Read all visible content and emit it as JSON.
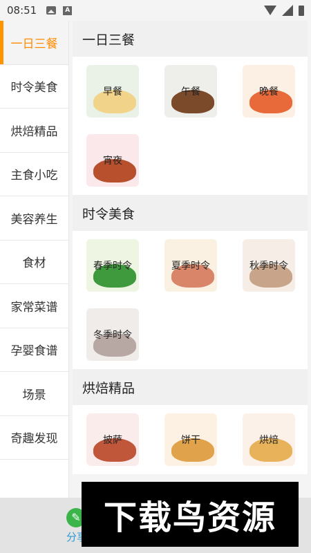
{
  "status_bar": {
    "time": "08:51"
  },
  "sidebar": {
    "items": [
      {
        "label": "一日三餐"
      },
      {
        "label": "时令美食"
      },
      {
        "label": "烘焙精品"
      },
      {
        "label": "主食小吃"
      },
      {
        "label": "美容养生"
      },
      {
        "label": "食材"
      },
      {
        "label": "家常菜谱"
      },
      {
        "label": "孕婴食谱"
      },
      {
        "label": "场景"
      },
      {
        "label": "奇趣发现"
      }
    ]
  },
  "sections": [
    {
      "title": "一日三餐",
      "tiles": [
        {
          "label": "早餐",
          "bg": "#eaf1e6",
          "food": "#f2d38a"
        },
        {
          "label": "午餐",
          "bg": "#eeeeea",
          "food": "#7a4a2a"
        },
        {
          "label": "晚餐",
          "bg": "#fbf0e3",
          "food": "#e86a3a"
        },
        {
          "label": "宵夜",
          "bg": "#fbe8ea",
          "food": "#b8502e"
        }
      ]
    },
    {
      "title": "时令美食",
      "tiles": [
        {
          "label": "春季时令",
          "bg": "#eef5e2",
          "food": "#3e9a3c"
        },
        {
          "label": "夏季时令",
          "bg": "#faf1e2",
          "food": "#d9856a"
        },
        {
          "label": "秋季时令",
          "bg": "#f6eee6",
          "food": "#c8a58a"
        },
        {
          "label": "冬季时令",
          "bg": "#efecea",
          "food": "#b8a8a4"
        }
      ]
    },
    {
      "title": "烘焙精品",
      "tiles": [
        {
          "label": "披萨",
          "bg": "#fbecec",
          "food": "#c0573a"
        },
        {
          "label": "饼干",
          "bg": "#fdf1e4",
          "food": "#e0a24a"
        },
        {
          "label": "烘焙",
          "bg": "#fbf1e8",
          "food": "#e7b25a"
        }
      ]
    }
  ],
  "bottom_nav": {
    "label": "分享",
    "icon": "pencil-icon"
  },
  "watermark": {
    "text": "下载鸟资源"
  }
}
